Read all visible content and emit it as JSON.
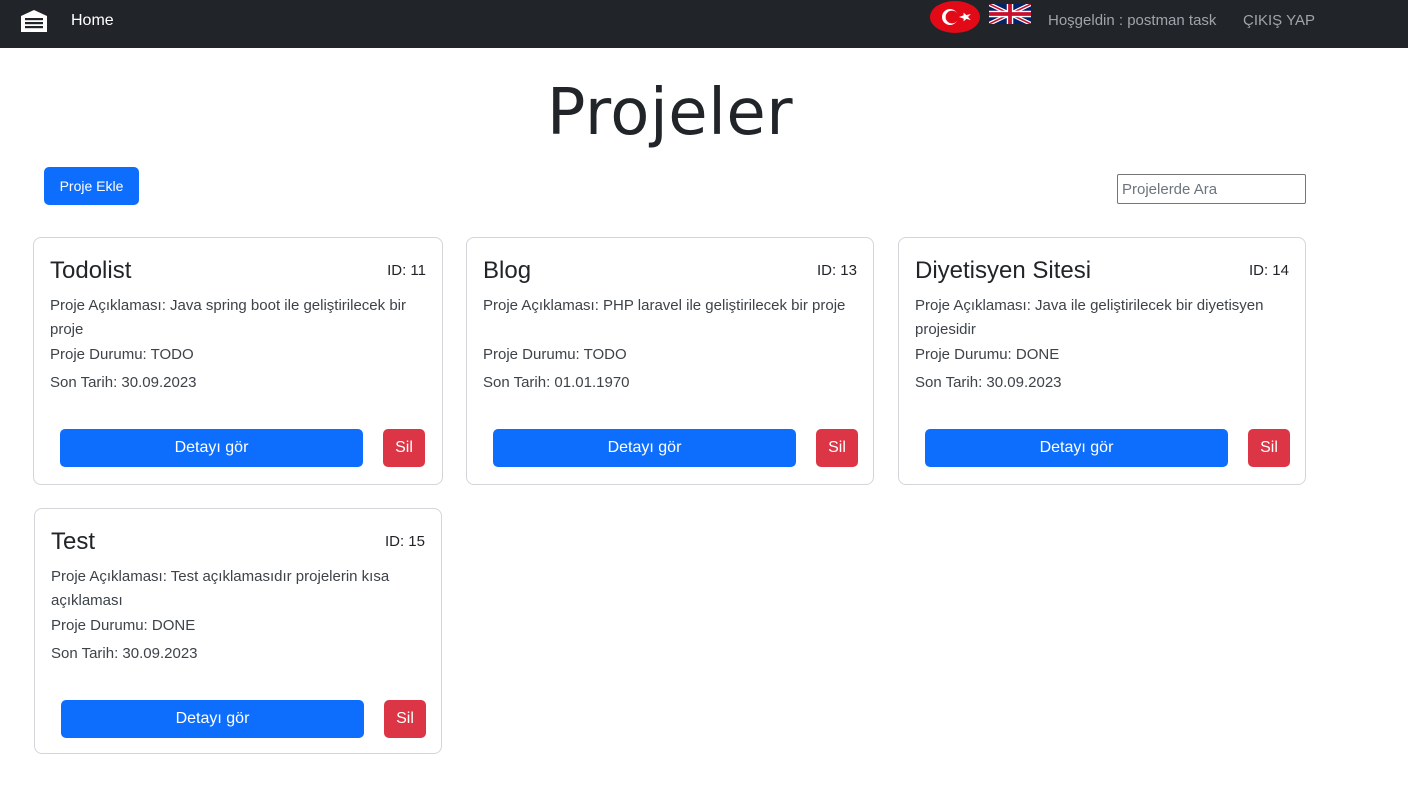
{
  "navbar": {
    "logo_icon": "warehouse-icon",
    "home_label": "Home",
    "flag_tr_icon": "turkey-flag-icon",
    "flag_uk_icon": "uk-flag-icon",
    "welcome_text": "Hoşgeldin : postman task",
    "logout_label": "ÇIKIŞ YAP"
  },
  "page": {
    "title": "Projeler",
    "add_button_label": "Proje Ekle",
    "search_placeholder": "Projelerde Ara"
  },
  "projects": [
    {
      "title": "Todolist",
      "id_label": "ID: 11",
      "description": "Proje Açıklaması: Java spring boot ile geliştirilecek bir proje",
      "status": "Proje Durumu: TODO",
      "due_date": "Son Tarih: 30.09.2023",
      "detail_label": "Detayı gör",
      "delete_label": "Sil"
    },
    {
      "title": "Blog",
      "id_label": "ID: 13",
      "description": "Proje Açıklaması: PHP laravel ile geliştirilecek bir proje",
      "status": "Proje Durumu: TODO",
      "due_date": "Son Tarih: 01.01.1970",
      "detail_label": "Detayı gör",
      "delete_label": "Sil"
    },
    {
      "title": "Diyetisyen Sitesi",
      "id_label": "ID: 14",
      "description": "Proje Açıklaması: Java ile geliştirilecek bir diyetisyen projesidir",
      "status": "Proje Durumu: DONE",
      "due_date": "Son Tarih: 30.09.2023",
      "detail_label": "Detayı gör",
      "delete_label": "Sil"
    },
    {
      "title": "Test",
      "id_label": "ID: 15",
      "description": "Proje Açıklaması: Test açıklamasıdır projelerin kısa açıklaması",
      "status": "Proje Durumu: DONE",
      "due_date": "Son Tarih: 30.09.2023",
      "detail_label": "Detayı gör",
      "delete_label": "Sil"
    }
  ],
  "colors": {
    "navbar_bg": "#212529",
    "primary": "#0d6efd",
    "danger": "#dc3545"
  }
}
